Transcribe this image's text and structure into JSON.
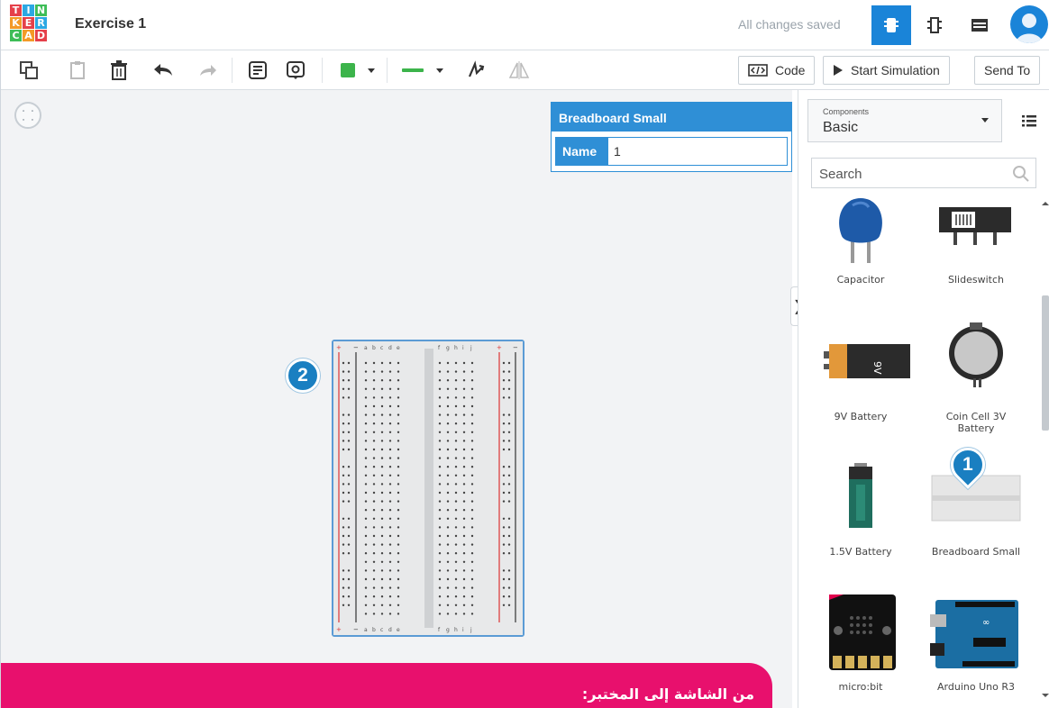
{
  "header": {
    "logo_letters": [
      "T",
      "I",
      "N",
      "K",
      "E",
      "R",
      "C",
      "A",
      "D"
    ],
    "title": "Exercise 1",
    "status": "All changes saved"
  },
  "toolbar": {
    "code_label": "Code",
    "simulate_label": "Start Simulation",
    "send_label": "Send To",
    "fill_color": "#3cb44b",
    "wire_color": "#3cb44b"
  },
  "inspector": {
    "title": "Breadboard Small",
    "name_label": "Name",
    "name_value": "1"
  },
  "breadboard": {
    "column_letters": [
      "a",
      "b",
      "c",
      "d",
      "e",
      "f",
      "g",
      "h",
      "i",
      "j"
    ],
    "rows": 30,
    "rail_plus": "+",
    "rail_minus": "−"
  },
  "panel": {
    "category_caption": "Components",
    "category_value": "Basic",
    "search_placeholder": "Search",
    "components": [
      {
        "label": "Capacitor",
        "icon": "capacitor-icon"
      },
      {
        "label": "Slideswitch",
        "icon": "slideswitch-icon"
      },
      {
        "label": "9V Battery",
        "icon": "battery-9v-icon"
      },
      {
        "label": "Coin Cell 3V\nBattery",
        "icon": "coin-cell-icon"
      },
      {
        "label": "1.5V Battery",
        "icon": "battery-aa-icon"
      },
      {
        "label": "Breadboard Small",
        "icon": "breadboard-icon"
      },
      {
        "label": "micro:bit",
        "icon": "microbit-icon"
      },
      {
        "label": "Arduino Uno R3",
        "icon": "arduino-icon"
      }
    ]
  },
  "callouts": {
    "pin1": "1",
    "pin2": "2"
  },
  "banner": {
    "text": "من الشاشة إلى المختبر:"
  },
  "colors": {
    "accent": "#1a84d8",
    "banner": "#e8106d",
    "pin": "#1a7fc1"
  }
}
